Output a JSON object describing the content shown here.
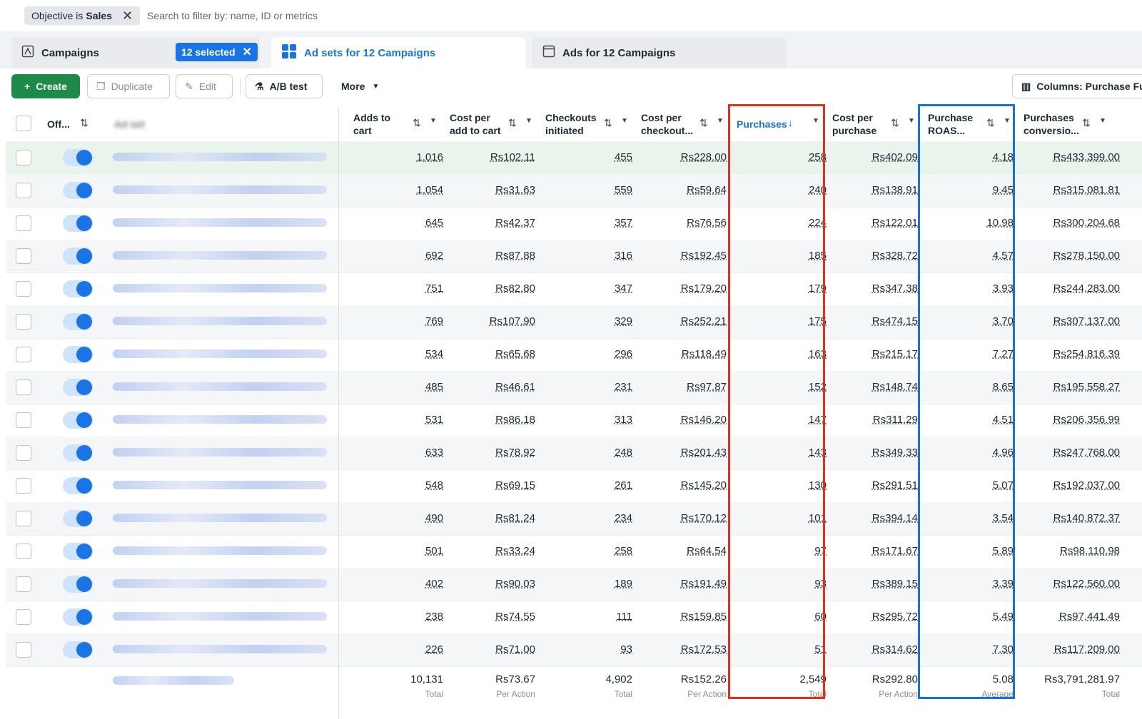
{
  "filter": {
    "chip_prefix": "Objective is",
    "chip_value": "Sales",
    "search_placeholder": "Search to filter by: name, ID or metrics"
  },
  "tabs": {
    "campaigns": "Campaigns",
    "selected": "12 selected",
    "adsets": "Ad sets for 12 Campaigns",
    "ads": "Ads for 12 Campaigns"
  },
  "toolbar": {
    "create": "Create",
    "duplicate": "Duplicate",
    "edit": "Edit",
    "ab_test": "A/B test",
    "more": "More",
    "columns": "Columns: Purchase Fu"
  },
  "columns": {
    "off": "Off...",
    "adset": "Ad set",
    "c1": [
      "Adds to",
      "cart"
    ],
    "c2": [
      "Cost per",
      "add to cart"
    ],
    "c3": [
      "Checkouts",
      "initiated"
    ],
    "c4": [
      "Cost per",
      "checkout..."
    ],
    "c5": "Purchases",
    "c6": [
      "Cost per",
      "purchase"
    ],
    "c7": [
      "Purchase",
      "ROAS..."
    ],
    "c8": [
      "Purchases",
      "conversio..."
    ]
  },
  "rows": [
    [
      "1,016",
      "Rs102.11",
      "455",
      "Rs228.00",
      "258",
      "Rs402.09",
      "4.18",
      "Rs433,399.00"
    ],
    [
      "1,054",
      "Rs31.63",
      "559",
      "Rs59.64",
      "240",
      "Rs138.91",
      "9.45",
      "Rs315,081.81"
    ],
    [
      "645",
      "Rs42.37",
      "357",
      "Rs76.56",
      "224",
      "Rs122.01",
      "10.98",
      "Rs300,204.68"
    ],
    [
      "692",
      "Rs87.88",
      "316",
      "Rs192.45",
      "185",
      "Rs328.72",
      "4.57",
      "Rs278,150.00"
    ],
    [
      "751",
      "Rs82.80",
      "347",
      "Rs179.20",
      "179",
      "Rs347.38",
      "3.93",
      "Rs244,283.00"
    ],
    [
      "769",
      "Rs107.90",
      "329",
      "Rs252.21",
      "175",
      "Rs474.15",
      "3.70",
      "Rs307,137.00"
    ],
    [
      "534",
      "Rs65.68",
      "296",
      "Rs118.49",
      "163",
      "Rs215.17",
      "7.27",
      "Rs254,816.39"
    ],
    [
      "485",
      "Rs46.61",
      "231",
      "Rs97.87",
      "152",
      "Rs148.74",
      "8.65",
      "Rs195,558.27"
    ],
    [
      "531",
      "Rs86.18",
      "313",
      "Rs146.20",
      "147",
      "Rs311.29",
      "4.51",
      "Rs206,356.99"
    ],
    [
      "633",
      "Rs78.92",
      "248",
      "Rs201.43",
      "143",
      "Rs349.33",
      "4.96",
      "Rs247,768.00"
    ],
    [
      "548",
      "Rs69.15",
      "261",
      "Rs145.20",
      "130",
      "Rs291.51",
      "5.07",
      "Rs192,037.00"
    ],
    [
      "490",
      "Rs81.24",
      "234",
      "Rs170.12",
      "101",
      "Rs394.14",
      "3.54",
      "Rs140,872.37"
    ],
    [
      "501",
      "Rs33.24",
      "258",
      "Rs64.54",
      "97",
      "Rs171.67",
      "5.89",
      "Rs98,110.98"
    ],
    [
      "402",
      "Rs90.03",
      "189",
      "Rs191.49",
      "93",
      "Rs389.15",
      "3.39",
      "Rs122,560.00"
    ],
    [
      "238",
      "Rs74.55",
      "111",
      "Rs159.85",
      "60",
      "Rs295.72",
      "5.49",
      "Rs97,441.49"
    ],
    [
      "226",
      "Rs71.00",
      "93",
      "Rs172.53",
      "51",
      "Rs314.62",
      "7.30",
      "Rs117,209.00"
    ]
  ],
  "totals": {
    "values": [
      "10,131",
      "Rs73.67",
      "4,902",
      "Rs152.26",
      "2,549",
      "Rs292.80",
      "5.08",
      "Rs3,791,281.97"
    ],
    "labels": [
      "Total",
      "Per Action",
      "Total",
      "Per Action",
      "Total",
      "Per Action",
      "Average",
      "Total"
    ]
  },
  "colors": {
    "accent": "#1b74e4",
    "create": "#1e8a4a",
    "highlight_red": "#e0311f",
    "highlight_blue": "#1b6fd8"
  }
}
